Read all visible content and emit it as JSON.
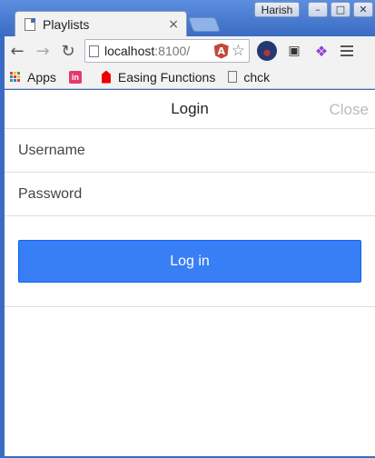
{
  "browser": {
    "tab_title": "Playlists",
    "tab_close": "×",
    "profile_name": "Harish",
    "window_buttons": {
      "minimize": "–",
      "maximize": "□",
      "close": "✕"
    },
    "url_host": "localhost",
    "url_port": ":8100/",
    "bookmarks": [
      {
        "label": "Apps",
        "icon": "apps-grid-icon"
      },
      {
        "label": "",
        "icon": "invision-icon"
      },
      {
        "label": "Easing Functions",
        "icon": "easing-icon"
      },
      {
        "label": "chck",
        "icon": "page-icon"
      }
    ]
  },
  "modal": {
    "title": "Login",
    "close_label": "Close",
    "username_placeholder": "Username",
    "password_placeholder": "Password",
    "login_button": "Log in"
  },
  "colors": {
    "accent": "#387ef5",
    "window_frame": "#3a6cc3"
  }
}
